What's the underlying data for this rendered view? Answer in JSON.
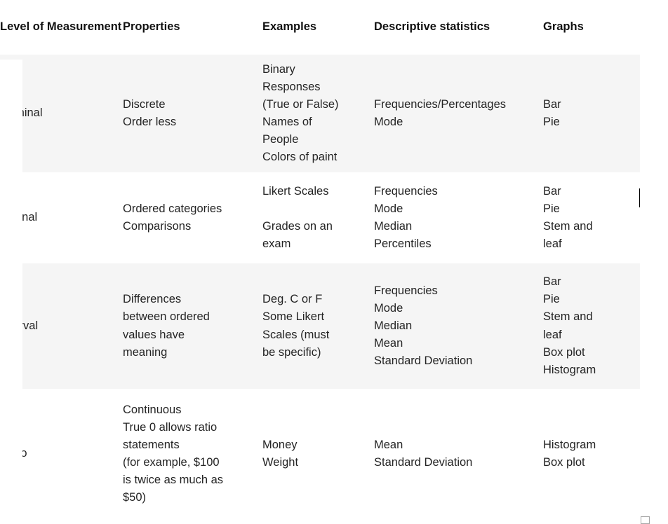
{
  "table": {
    "columns": [
      {
        "key": "level",
        "label": "Level of\nMeasurement"
      },
      {
        "key": "props",
        "label": "Properties"
      },
      {
        "key": "examp",
        "label": "Examples"
      },
      {
        "key": "stats",
        "label": "Descriptive statistics"
      },
      {
        "key": "graphs",
        "label": "Graphs"
      }
    ],
    "header": {
      "level": "Level of\nMeasurement",
      "properties": "Properties",
      "examples": "Examples",
      "descriptive_statistics": "Descriptive statistics",
      "graphs": "Graphs"
    },
    "rows": [
      {
        "level": "Nominal",
        "properties": "Discrete\nOrder less",
        "examples": "Binary\nResponses\n(True or False)\nNames of\nPeople\nColors of paint",
        "descriptive_statistics": "Frequencies/Percentages\nMode",
        "graphs": "Bar\nPie",
        "shaded": true
      },
      {
        "level": "Ordinal",
        "properties": "Ordered categories\nComparisons",
        "examples": "Likert Scales\n\nGrades on an\nexam",
        "descriptive_statistics": "Frequencies\nMode\nMedian\nPercentiles",
        "graphs": "Bar\nPie\nStem and\nleaf",
        "shaded": false
      },
      {
        "level": "Interval",
        "properties": "Differences\nbetween ordered\nvalues have\nmeaning",
        "examples": "Deg. C or F\nSome Likert\nScales (must\nbe specific)",
        "descriptive_statistics": "Frequencies\nMode\nMedian\nMean\nStandard Deviation",
        "graphs": "Bar\nPie\nStem and\nleaf\nBox plot\nHistogram",
        "shaded": true
      },
      {
        "level": "Ratio",
        "properties": "Continuous\nTrue 0 allows ratio\nstatements\n(for example, $100\nis twice as much as\n$50)",
        "examples": "Money\nWeight",
        "descriptive_statistics": "Mean\nStandard Deviation",
        "graphs": "Histogram\nBox plot",
        "shaded": false
      }
    ]
  },
  "colors": {
    "shaded_row": "#f5f5f5",
    "page_background": "#ffffff",
    "header_text": "#111111",
    "body_text": "#242424",
    "resize_handle_border": "#a6a6a6"
  }
}
